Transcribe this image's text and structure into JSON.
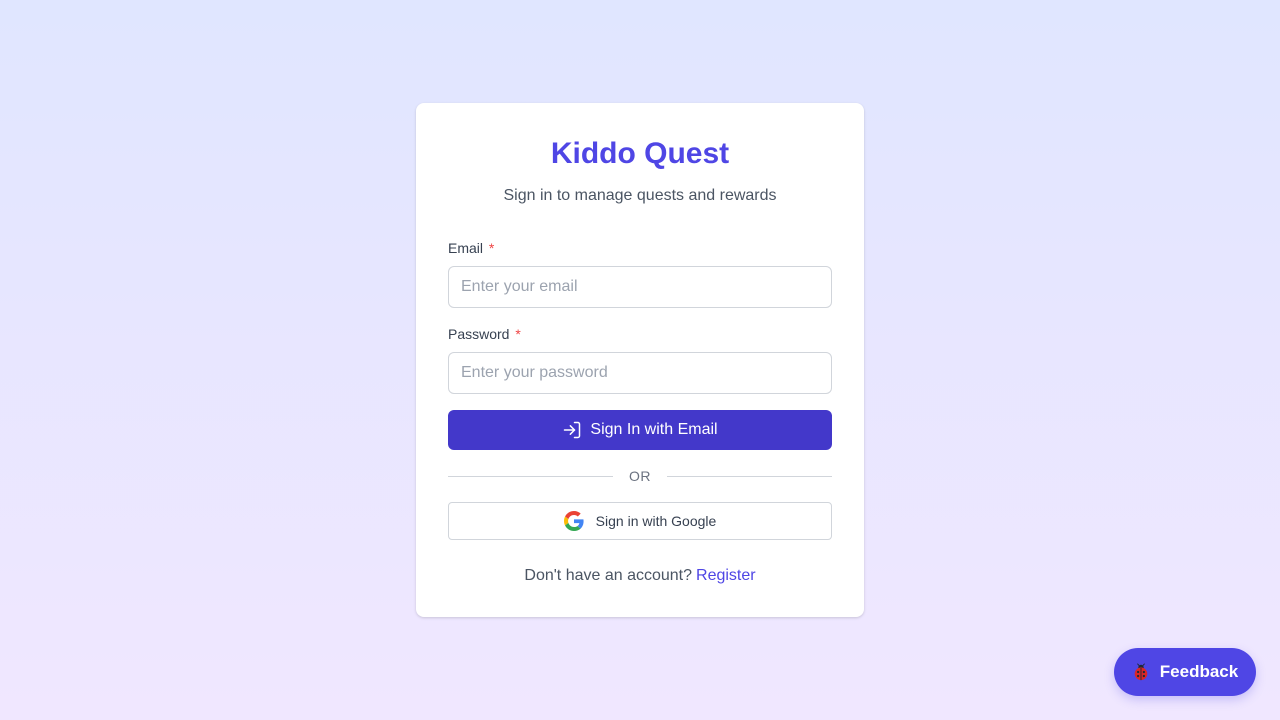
{
  "app": {
    "title": "Kiddo Quest",
    "subtitle": "Sign in to manage quests and rewards"
  },
  "form": {
    "email": {
      "label": "Email",
      "required_mark": "*",
      "placeholder": "Enter your email",
      "value": ""
    },
    "password": {
      "label": "Password",
      "required_mark": "*",
      "placeholder": "Enter your password",
      "value": ""
    },
    "submit_label": "Sign In with Email",
    "divider_label": "OR",
    "google_label": "Sign in with Google"
  },
  "footer": {
    "prompt": "Don't have an account?",
    "register_label": "Register"
  },
  "feedback": {
    "label": "Feedback",
    "icon": "ladybug-icon"
  },
  "icons": {
    "submit": "sign-in-icon",
    "google": "google-icon"
  },
  "colors": {
    "accent": "#4f46e5",
    "primary_button": "#4338ca",
    "required": "#ef4444",
    "background_top": "#e0e6ff",
    "background_bottom": "#f0e7ff"
  }
}
